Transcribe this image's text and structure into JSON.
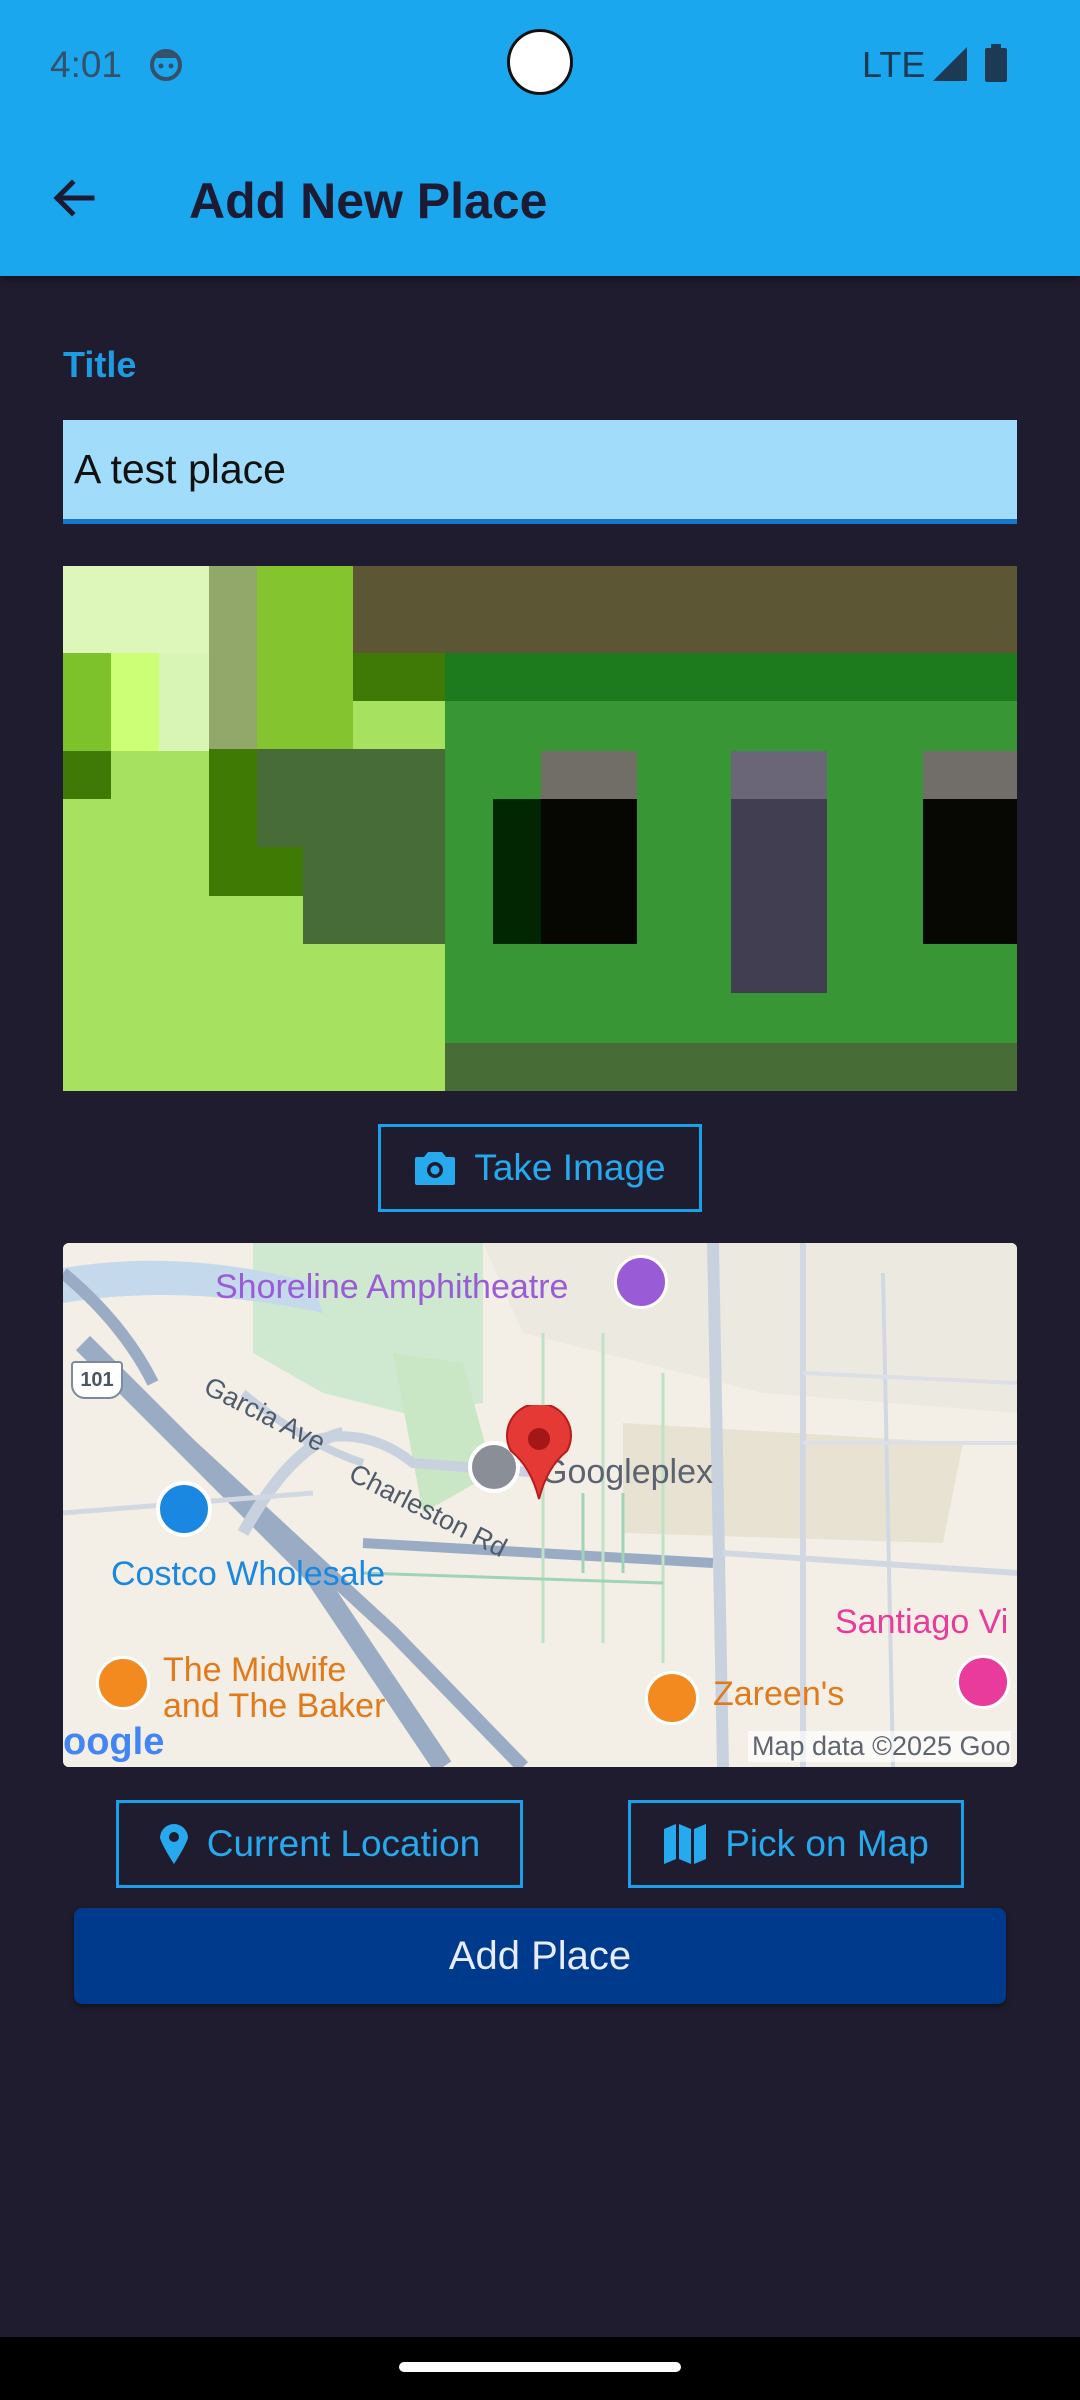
{
  "status_bar": {
    "time": "4:01",
    "network": "LTE"
  },
  "app_bar": {
    "title": "Add New Place"
  },
  "form": {
    "title_label": "Title",
    "title_value": "A test place"
  },
  "buttons": {
    "take_image": "Take Image",
    "current_location": "Current Location",
    "pick_on_map": "Pick on Map",
    "add_place": "Add Place"
  },
  "map": {
    "labels": {
      "shoreline": "Shoreline Amphitheatre",
      "garcia": "Garcia Ave",
      "route": "101",
      "charleston": "Charleston Rd",
      "googleplex": "Googleplex",
      "costco": "Costco Wholesale",
      "midwife_1": "The Midwife",
      "midwife_2": "and The Baker",
      "zareens": "Zareen's",
      "santiago": "Santiago Vi",
      "google_logo": "oogle",
      "attribution": "Map data ©2025 Goo"
    },
    "colors": {
      "poi_purple": "#9a5bd6",
      "poi_orange": "#f28a1f",
      "poi_pink": "#e83b9b",
      "marker_red": "#e53935",
      "road": "#9aabc4",
      "costco_blue": "#1a88e0"
    }
  },
  "icons": {
    "back": "arrow-left-icon",
    "camera": "camera-icon",
    "location": "location-pin-icon",
    "map": "map-icon",
    "android": "android-status-icon",
    "signal": "signal-icon",
    "battery": "battery-icon"
  },
  "colors": {
    "app_bar": "#1aa7ee",
    "background": "#201c2f",
    "accent": "#1aa0e8",
    "primary_button": "#003a8c",
    "input_fill": "#a1dcfa"
  }
}
